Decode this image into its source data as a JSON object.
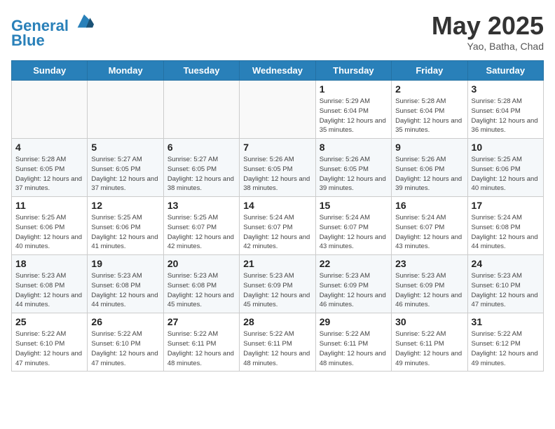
{
  "header": {
    "logo_line1": "General",
    "logo_line2": "Blue",
    "month": "May 2025",
    "location": "Yao, Batha, Chad"
  },
  "weekdays": [
    "Sunday",
    "Monday",
    "Tuesday",
    "Wednesday",
    "Thursday",
    "Friday",
    "Saturday"
  ],
  "weeks": [
    [
      {
        "day": "",
        "info": ""
      },
      {
        "day": "",
        "info": ""
      },
      {
        "day": "",
        "info": ""
      },
      {
        "day": "",
        "info": ""
      },
      {
        "day": "1",
        "info": "Sunrise: 5:29 AM\nSunset: 6:04 PM\nDaylight: 12 hours and 35 minutes."
      },
      {
        "day": "2",
        "info": "Sunrise: 5:28 AM\nSunset: 6:04 PM\nDaylight: 12 hours and 35 minutes."
      },
      {
        "day": "3",
        "info": "Sunrise: 5:28 AM\nSunset: 6:04 PM\nDaylight: 12 hours and 36 minutes."
      }
    ],
    [
      {
        "day": "4",
        "info": "Sunrise: 5:28 AM\nSunset: 6:05 PM\nDaylight: 12 hours and 37 minutes."
      },
      {
        "day": "5",
        "info": "Sunrise: 5:27 AM\nSunset: 6:05 PM\nDaylight: 12 hours and 37 minutes."
      },
      {
        "day": "6",
        "info": "Sunrise: 5:27 AM\nSunset: 6:05 PM\nDaylight: 12 hours and 38 minutes."
      },
      {
        "day": "7",
        "info": "Sunrise: 5:26 AM\nSunset: 6:05 PM\nDaylight: 12 hours and 38 minutes."
      },
      {
        "day": "8",
        "info": "Sunrise: 5:26 AM\nSunset: 6:05 PM\nDaylight: 12 hours and 39 minutes."
      },
      {
        "day": "9",
        "info": "Sunrise: 5:26 AM\nSunset: 6:06 PM\nDaylight: 12 hours and 39 minutes."
      },
      {
        "day": "10",
        "info": "Sunrise: 5:25 AM\nSunset: 6:06 PM\nDaylight: 12 hours and 40 minutes."
      }
    ],
    [
      {
        "day": "11",
        "info": "Sunrise: 5:25 AM\nSunset: 6:06 PM\nDaylight: 12 hours and 40 minutes."
      },
      {
        "day": "12",
        "info": "Sunrise: 5:25 AM\nSunset: 6:06 PM\nDaylight: 12 hours and 41 minutes."
      },
      {
        "day": "13",
        "info": "Sunrise: 5:25 AM\nSunset: 6:07 PM\nDaylight: 12 hours and 42 minutes."
      },
      {
        "day": "14",
        "info": "Sunrise: 5:24 AM\nSunset: 6:07 PM\nDaylight: 12 hours and 42 minutes."
      },
      {
        "day": "15",
        "info": "Sunrise: 5:24 AM\nSunset: 6:07 PM\nDaylight: 12 hours and 43 minutes."
      },
      {
        "day": "16",
        "info": "Sunrise: 5:24 AM\nSunset: 6:07 PM\nDaylight: 12 hours and 43 minutes."
      },
      {
        "day": "17",
        "info": "Sunrise: 5:24 AM\nSunset: 6:08 PM\nDaylight: 12 hours and 44 minutes."
      }
    ],
    [
      {
        "day": "18",
        "info": "Sunrise: 5:23 AM\nSunset: 6:08 PM\nDaylight: 12 hours and 44 minutes."
      },
      {
        "day": "19",
        "info": "Sunrise: 5:23 AM\nSunset: 6:08 PM\nDaylight: 12 hours and 44 minutes."
      },
      {
        "day": "20",
        "info": "Sunrise: 5:23 AM\nSunset: 6:08 PM\nDaylight: 12 hours and 45 minutes."
      },
      {
        "day": "21",
        "info": "Sunrise: 5:23 AM\nSunset: 6:09 PM\nDaylight: 12 hours and 45 minutes."
      },
      {
        "day": "22",
        "info": "Sunrise: 5:23 AM\nSunset: 6:09 PM\nDaylight: 12 hours and 46 minutes."
      },
      {
        "day": "23",
        "info": "Sunrise: 5:23 AM\nSunset: 6:09 PM\nDaylight: 12 hours and 46 minutes."
      },
      {
        "day": "24",
        "info": "Sunrise: 5:23 AM\nSunset: 6:10 PM\nDaylight: 12 hours and 47 minutes."
      }
    ],
    [
      {
        "day": "25",
        "info": "Sunrise: 5:22 AM\nSunset: 6:10 PM\nDaylight: 12 hours and 47 minutes."
      },
      {
        "day": "26",
        "info": "Sunrise: 5:22 AM\nSunset: 6:10 PM\nDaylight: 12 hours and 47 minutes."
      },
      {
        "day": "27",
        "info": "Sunrise: 5:22 AM\nSunset: 6:11 PM\nDaylight: 12 hours and 48 minutes."
      },
      {
        "day": "28",
        "info": "Sunrise: 5:22 AM\nSunset: 6:11 PM\nDaylight: 12 hours and 48 minutes."
      },
      {
        "day": "29",
        "info": "Sunrise: 5:22 AM\nSunset: 6:11 PM\nDaylight: 12 hours and 48 minutes."
      },
      {
        "day": "30",
        "info": "Sunrise: 5:22 AM\nSunset: 6:11 PM\nDaylight: 12 hours and 49 minutes."
      },
      {
        "day": "31",
        "info": "Sunrise: 5:22 AM\nSunset: 6:12 PM\nDaylight: 12 hours and 49 minutes."
      }
    ]
  ]
}
